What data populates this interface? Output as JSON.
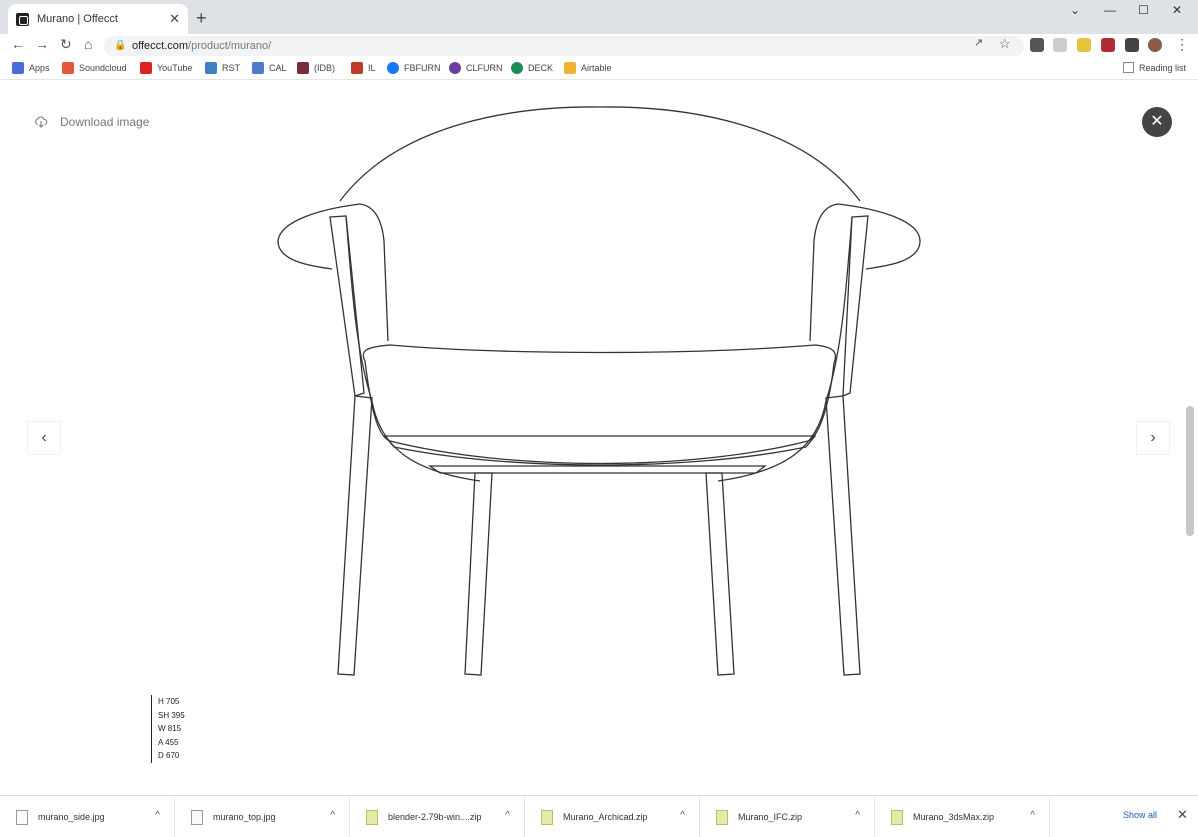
{
  "tab": {
    "title": "Murano | Offecct",
    "close": "✕",
    "new": "+"
  },
  "window_controls": {
    "chevron": "⌄",
    "minimize": "—",
    "maximize": "☐",
    "close": "✕"
  },
  "nav": {
    "back": "←",
    "forward": "→",
    "reload": "↻",
    "home": "⌂",
    "menu": "⋮"
  },
  "address": {
    "domain": "offecct.com",
    "path": "/product/murano/"
  },
  "bookmarks": [
    {
      "label": "Apps",
      "color": "#4a6cd4"
    },
    {
      "label": "Soundcloud",
      "color": "#e8553d"
    },
    {
      "label": "YouTube",
      "color": "#e02020"
    },
    {
      "label": "RST",
      "color": "#3f82c4"
    },
    {
      "label": "CAL",
      "color": "#4e7bc9"
    },
    {
      "label": "(IDB)",
      "color": "#7a2d3a"
    },
    {
      "label": "IL",
      "color": "#c0392b"
    },
    {
      "label": "FBFURN",
      "color": "#1877f2"
    },
    {
      "label": "CLFURN",
      "color": "#6a3fa0"
    },
    {
      "label": "DECK",
      "color": "#1e8c5a"
    },
    {
      "label": "Airtable",
      "color": "#f2b233"
    }
  ],
  "reading_list": "Reading list",
  "page": {
    "download_label": "Download image",
    "close": "✕",
    "prev": "‹",
    "next": "›",
    "dimensions": [
      "H 705",
      "SH 395",
      "W 815",
      "A 455",
      "D 670"
    ]
  },
  "downloads": [
    {
      "name": "murano_side.jpg",
      "type": "jpg"
    },
    {
      "name": "murano_top.jpg",
      "type": "jpg"
    },
    {
      "name": "blender-2.79b-win....zip",
      "type": "zip"
    },
    {
      "name": "Murano_Archicad.zip",
      "type": "zip"
    },
    {
      "name": "Murano_IFC.zip",
      "type": "zip"
    },
    {
      "name": "Murano_3dsMax.zip",
      "type": "zip"
    }
  ],
  "shelf": {
    "show_all": "Show all",
    "close": "✕",
    "caret": "^"
  }
}
